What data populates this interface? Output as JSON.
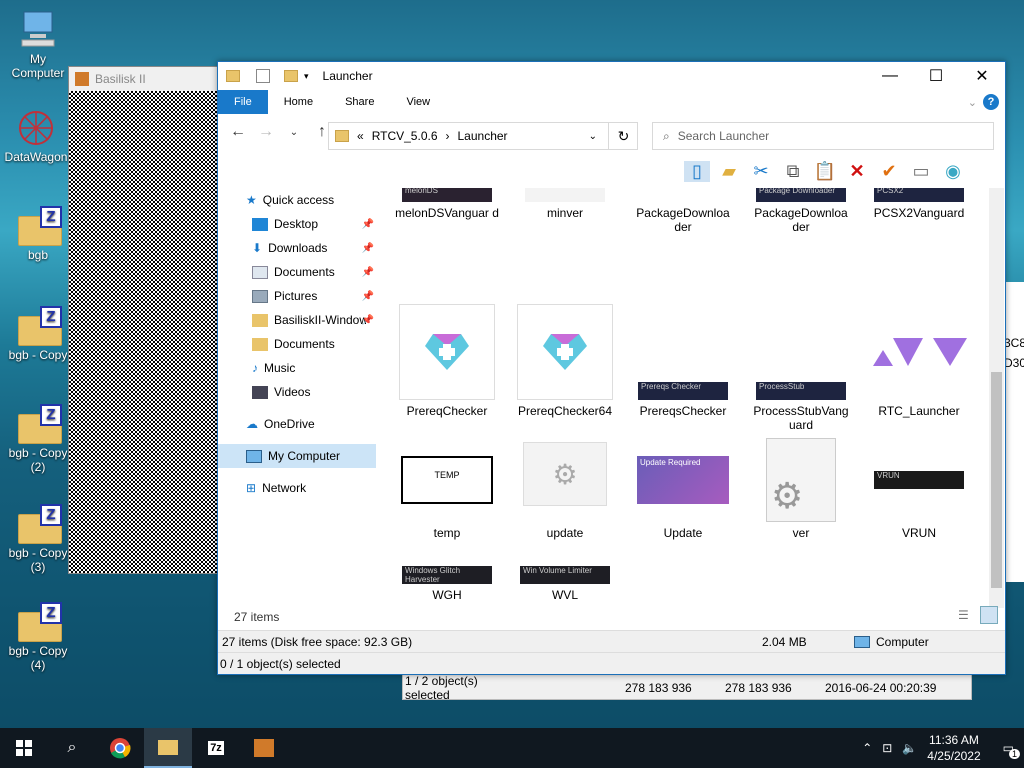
{
  "desktop": {
    "icons": [
      {
        "label": "My Computer"
      },
      {
        "label": "DataWagon"
      },
      {
        "label": "bgb"
      },
      {
        "label": "bgb - Copy"
      },
      {
        "label": "bgb - Copy (2)"
      },
      {
        "label": "bgb - Copy (3)"
      },
      {
        "label": "bgb - Copy (4)"
      }
    ]
  },
  "basilisk": {
    "title": "Basilisk II"
  },
  "back_window": {
    "selection": "1 / 2 object(s) selected",
    "size1": "278 183 936",
    "size2": "278 183 936",
    "date": "2016-06-24 00:20:39",
    "right_text_1": "3C8",
    "right_text_2": "D30"
  },
  "window": {
    "title": "Launcher",
    "ribbon": {
      "file": "File",
      "home": "Home",
      "share": "Share",
      "view": "View"
    },
    "address": {
      "prefix": "«",
      "seg1": "RTCV_5.0.6",
      "sep": "›",
      "seg2": "Launcher"
    },
    "search": {
      "placeholder": "Search Launcher"
    },
    "sidebar": [
      {
        "label": "Quick access"
      },
      {
        "label": "Desktop"
      },
      {
        "label": "Downloads"
      },
      {
        "label": "Documents"
      },
      {
        "label": "Pictures"
      },
      {
        "label": "BasiliskII-Window"
      },
      {
        "label": "Documents"
      },
      {
        "label": "Music"
      },
      {
        "label": "Videos"
      },
      {
        "label": "OneDrive"
      },
      {
        "label": "My Computer"
      },
      {
        "label": "Network"
      }
    ],
    "files": [
      {
        "name": "melonDSVanguar d",
        "thumb": "melonDS"
      },
      {
        "name": "minver",
        "thumb": ""
      },
      {
        "name": "PackageDownloa der",
        "thumb": ""
      },
      {
        "name": "PackageDownloa der",
        "thumb": "Package Downloader"
      },
      {
        "name": "PCSX2Vanguard",
        "thumb": "PCSX2"
      },
      {
        "name": "PrereqChecker",
        "thumb": ""
      },
      {
        "name": "PrereqChecker64",
        "thumb": ""
      },
      {
        "name": "PrereqsChecker",
        "thumb": "Prereqs Checker"
      },
      {
        "name": "ProcessStubVang uard",
        "thumb": "ProcessStub"
      },
      {
        "name": "RTC_Launcher",
        "thumb": ""
      },
      {
        "name": "temp",
        "thumb": "TEMP"
      },
      {
        "name": "update",
        "thumb": ""
      },
      {
        "name": "Update",
        "thumb": "Update Required"
      },
      {
        "name": "ver",
        "thumb": ""
      },
      {
        "name": "VRUN",
        "thumb": "VRUN"
      },
      {
        "name": "WGH",
        "thumb": "Windows Glitch Harvester"
      },
      {
        "name": "WVL",
        "thumb": "Win Volume Limiter"
      }
    ],
    "items_count": "27 items",
    "status": {
      "items": "27 items (Disk free space: 92.3 GB)",
      "size": "2.04 MB",
      "location": "Computer"
    },
    "selection": "0 / 1 object(s) selected"
  },
  "taskbar": {
    "time": "11:36 AM",
    "date": "4/25/2022",
    "notifications": "1"
  }
}
